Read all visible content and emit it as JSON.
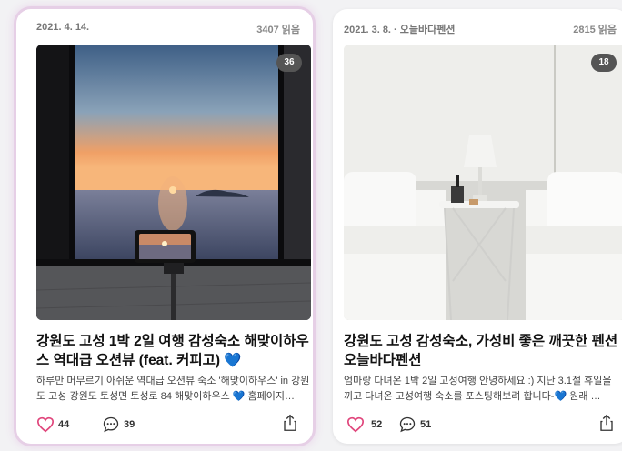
{
  "posts": [
    {
      "date": "2021. 4. 14.",
      "views": "3407 읽음",
      "photo_count": "36",
      "title_parts": [
        "강원도 고성 1박 2일 여행 감성숙소 해맞이하우스 역대급 오션뷰 (feat. 커피고) ",
        "💙"
      ],
      "excerpt": "하루만 머무르기 아쉬운 역대급 오션뷰 숙소 '해맞이하우스' in 강원도 고성 강원도 토성면 토성로 84 해맞이하우스 💙 홈페이지…",
      "likes": "44",
      "comments": "39"
    },
    {
      "date": "2021. 3. 8. · 오늘바다펜션",
      "views": "2815 읽음",
      "photo_count": "18",
      "title_parts": [
        "강원도 고성 감성숙소, 가성비 좋은 깨끗한 펜션 오늘바다펜션",
        ""
      ],
      "excerpt": "엄마랑 다녀온 1박 2일 고성여행 안녕하세요 :) 지난 3.1절 휴일을 끼고 다녀온 고성여행 숙소를 포스팅해보려 합니다-💙 원래 …",
      "likes": "52",
      "comments": "51"
    }
  ],
  "colors": {
    "heart": "#e0457b",
    "accent_border": "#e6cfe6",
    "heart_emoji": "#2b7de9"
  },
  "icons": {
    "like": "heart-icon",
    "comment": "comment-icon",
    "share": "share-icon"
  }
}
